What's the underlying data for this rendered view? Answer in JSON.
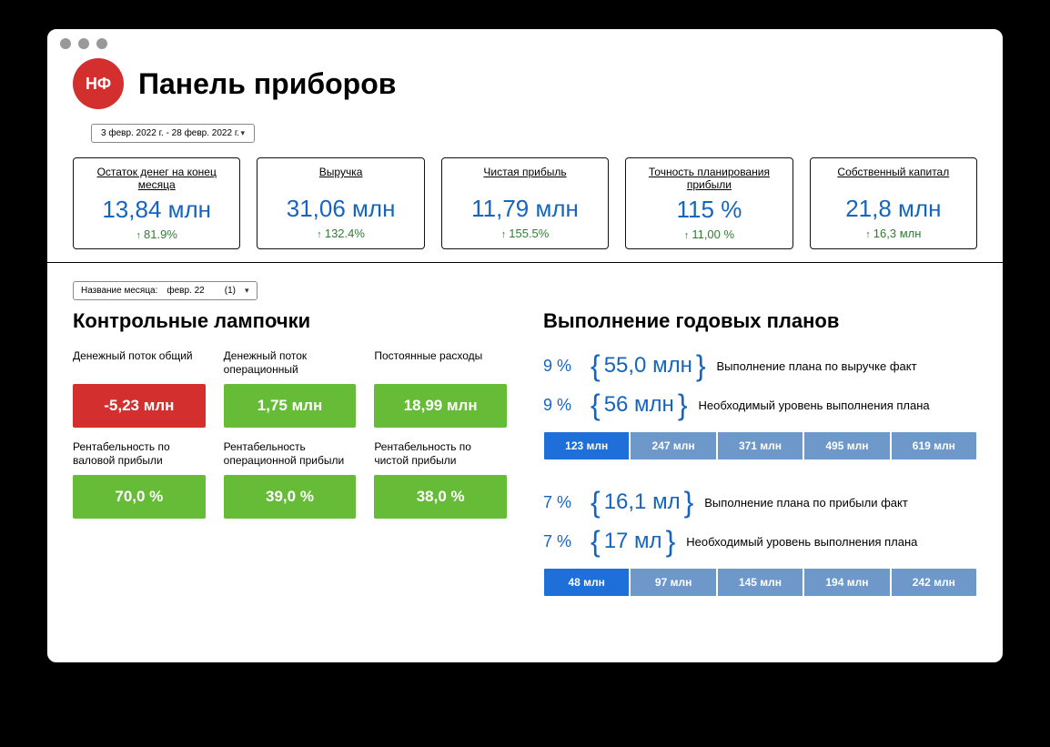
{
  "header": {
    "logo_text": "НФ",
    "title": "Панель приборов"
  },
  "date_range": "3 февр. 2022 г. - 28 февр. 2022 г.",
  "kpis": [
    {
      "label": "Остаток денег на конец месяца",
      "value": "13,84 млн",
      "delta": "81.9%"
    },
    {
      "label": "Выручка",
      "value": "31,06 млн",
      "delta": "132.4%"
    },
    {
      "label": "Чистая прибыль",
      "value": "11,79 млн",
      "delta": "155.5%"
    },
    {
      "label": "Точность планирования прибыли",
      "value": "115 %",
      "delta": "11,00 %"
    },
    {
      "label": "Собственный капитал",
      "value": "21,8 млн",
      "delta": "16,3 млн"
    }
  ],
  "month_filter": {
    "label": "Название месяца:",
    "value": "февр. 22",
    "count": "(1)"
  },
  "lamps": {
    "title": "Контрольные лампочки",
    "items": [
      {
        "label": "Денежный поток общий",
        "value": "-5,23 млн",
        "color": "red"
      },
      {
        "label": "Денежный поток операционный",
        "value": "1,75 млн",
        "color": "green"
      },
      {
        "label": "Постоянные расходы",
        "value": "18,99 млн",
        "color": "green"
      },
      {
        "label": "Рентабельность по валовой прибыли",
        "value": "70,0 %",
        "color": "green"
      },
      {
        "label": "Рентабельность операционной прибыли",
        "value": "39,0 %",
        "color": "green"
      },
      {
        "label": "Рентабельность по чистой прибыли",
        "value": "38,0 %",
        "color": "green"
      }
    ]
  },
  "plans": {
    "title": "Выполнение годовых планов",
    "revenue": {
      "fact_pct": "9 %",
      "fact_val": "55,0 млн",
      "fact_desc": "Выполнение плана по выручке факт",
      "need_pct": "9 %",
      "need_val": "56 млн",
      "need_desc": "Необходимый уровень выполнения плана",
      "scale": [
        "123 млн",
        "247 млн",
        "371 млн",
        "495 млн",
        "619 млн"
      ]
    },
    "profit": {
      "fact_pct": "7 %",
      "fact_val": "16,1 мл",
      "fact_desc": "Выполнение плана по прибыли факт",
      "need_pct": "7 %",
      "need_val": "17 мл",
      "need_desc": "Необходимый уровень выполнения плана",
      "scale": [
        "48 млн",
        "97 млн",
        "145 млн",
        "194 млн",
        "242 млн"
      ]
    }
  }
}
